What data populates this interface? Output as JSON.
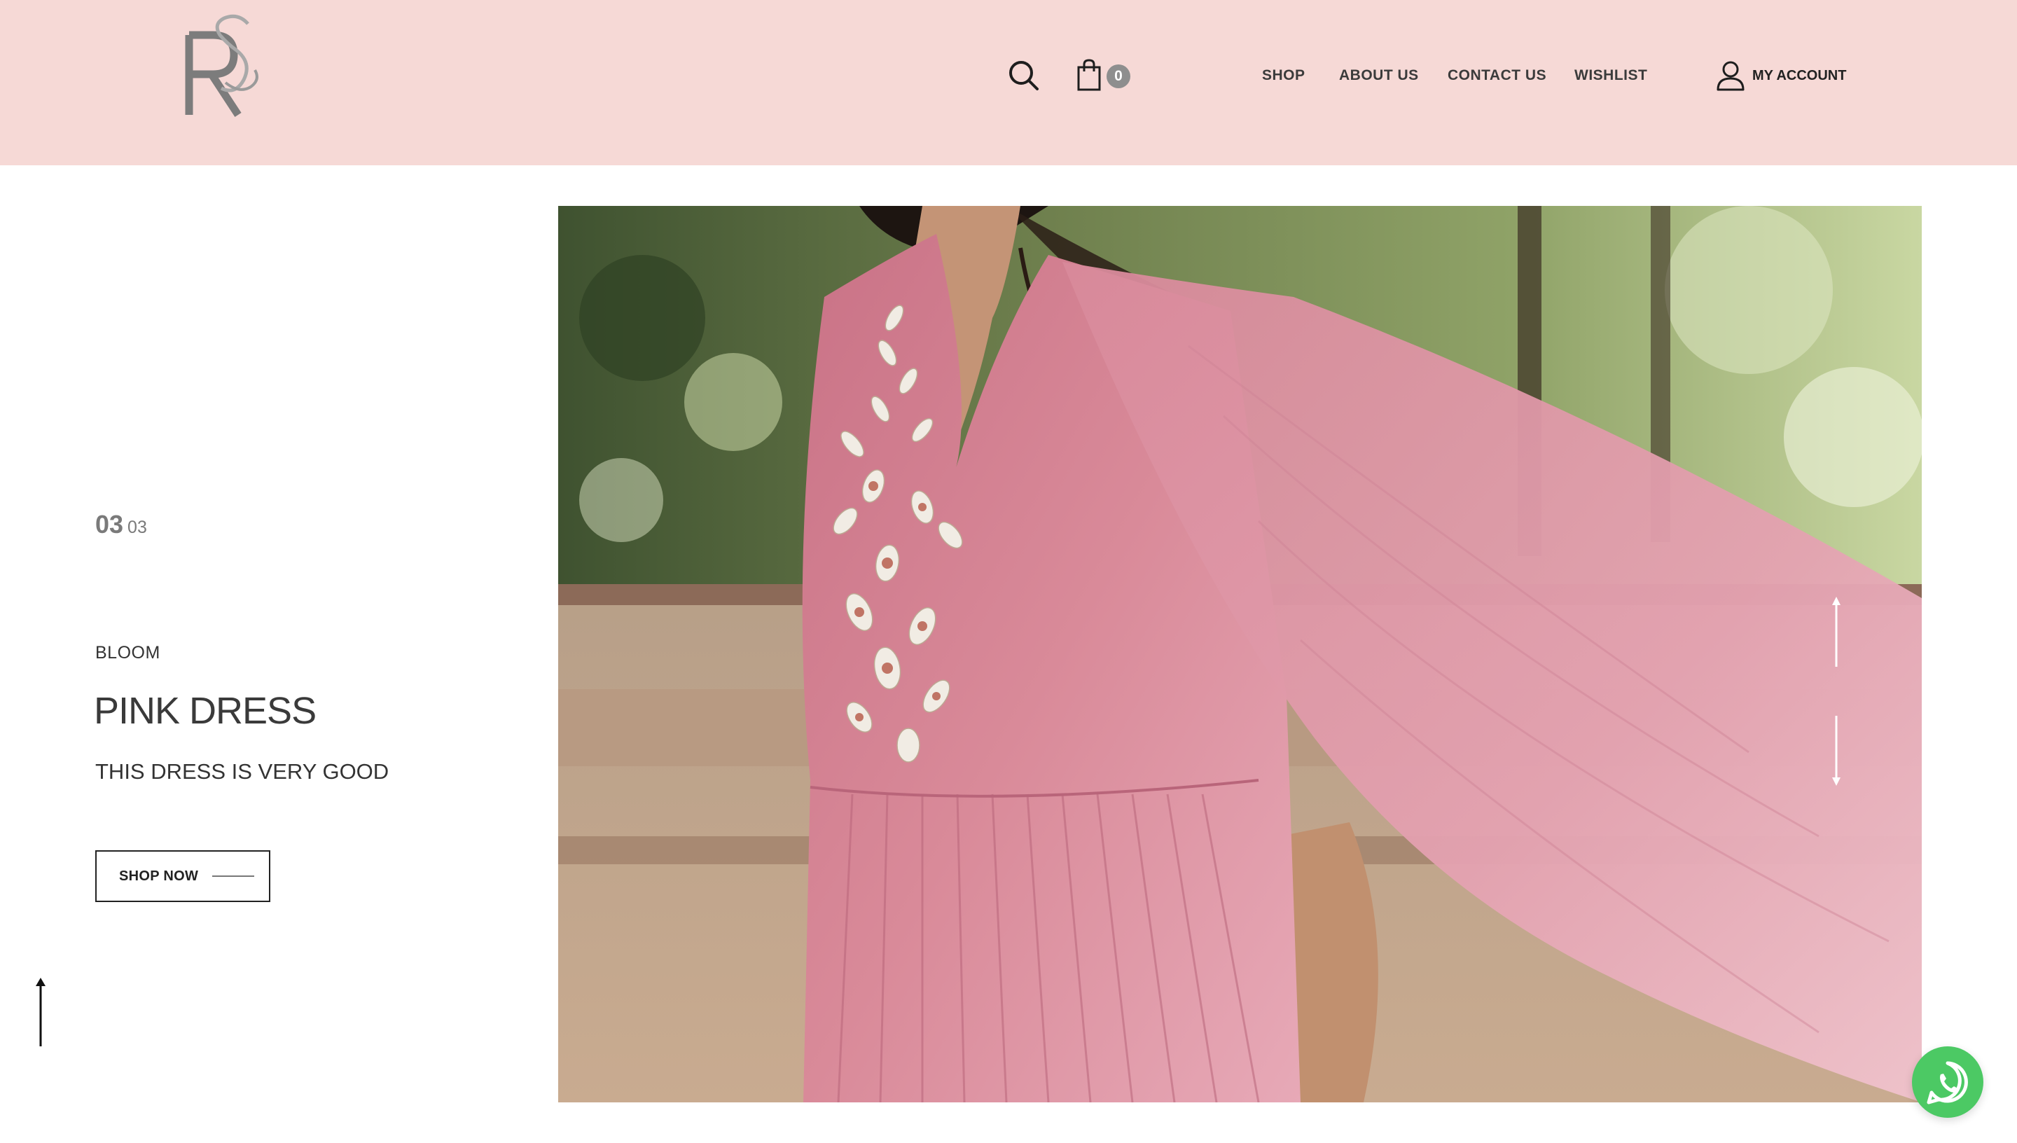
{
  "header": {
    "logo_text": "RS",
    "cart_count": "0",
    "nav": [
      "SHOP",
      "ABOUT US",
      "CONTACT US",
      "WISHLIST"
    ],
    "account_label": "MY ACCOUNT"
  },
  "slide": {
    "current": "03",
    "total": "03",
    "collection": "BLOOM",
    "title": "PINK DRESS",
    "description": "THIS DRESS IS VERY GOOD",
    "cta_label": "SHOP NOW"
  },
  "hero_image": {
    "alt": "Pink dress with embellished bodice"
  },
  "colors": {
    "header_bg": "#f6d9d6",
    "dress_pink": "#d98a99",
    "whatsapp_green": "#4cc964"
  },
  "icons": [
    "search-icon",
    "shopping-bag-icon",
    "user-icon",
    "arrow-up-icon",
    "arrow-down-icon",
    "whatsapp-icon"
  ]
}
